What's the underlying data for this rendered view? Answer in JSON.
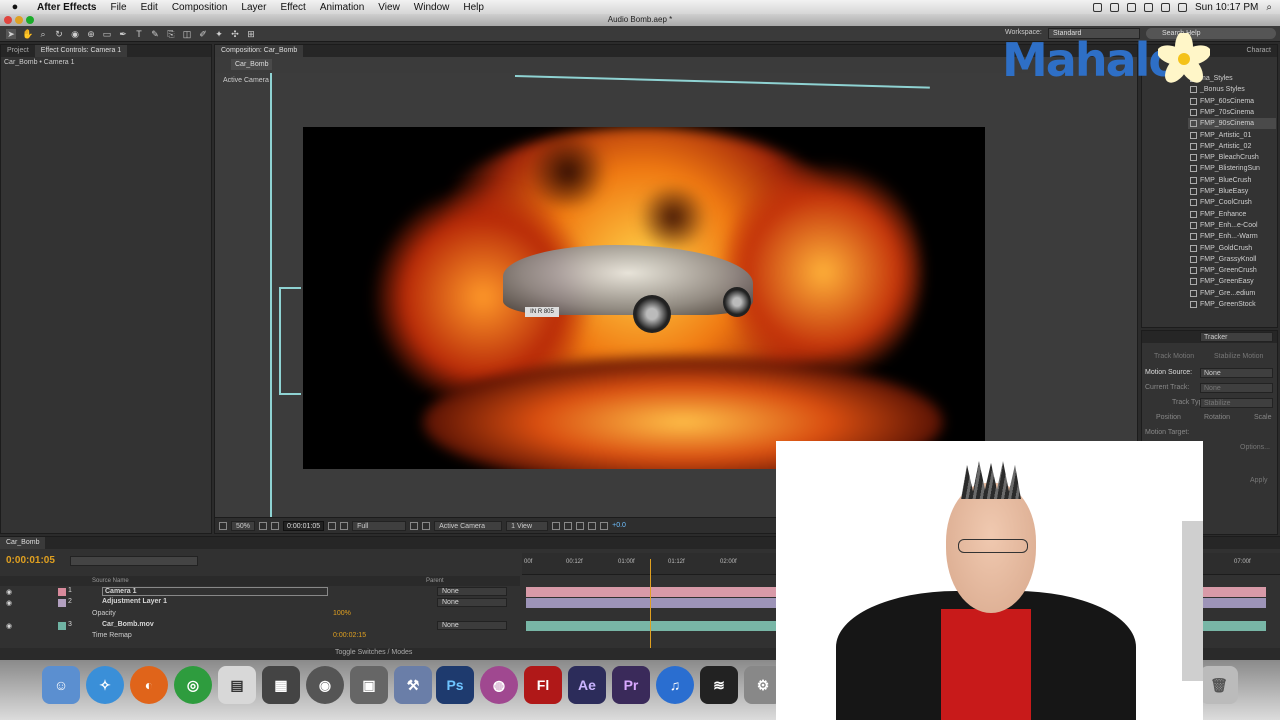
{
  "menubar": {
    "app": "After Effects",
    "items": [
      "File",
      "Edit",
      "Composition",
      "Layer",
      "Effect",
      "Animation",
      "View",
      "Window",
      "Help"
    ],
    "clock": "Sun 10:17 PM"
  },
  "window": {
    "title": "Audio Bomb.aep *"
  },
  "toolbar": {
    "workspace_label": "Workspace:",
    "workspace_value": "Standard",
    "search_placeholder": "Search Help"
  },
  "left_panel": {
    "tabs": [
      "Project",
      "Effect Controls: Camera 1"
    ],
    "subtitle": "Car_Bomb • Camera 1"
  },
  "viewer": {
    "tab": "Composition: Car_Bomb",
    "comp_tab": "Car_Bomb",
    "camera_label": "Active Camera",
    "zoom": "50%",
    "timecode": "0:00:01:05",
    "resolution": "Full",
    "camera_select": "Active Camera",
    "views": "1 View",
    "exposure": "+0.0",
    "plate_text": "IN R 805"
  },
  "effects_panel": {
    "tabs": [
      "Charact"
    ],
    "items": [
      "ma_Styles",
      "_Bonus Styles",
      "FMP_60sCinema",
      "FMP_70sCinema",
      "FMP_90sCinema",
      "FMP_Artistic_01",
      "FMP_Artistic_02",
      "FMP_BleachCrush",
      "FMP_BlisteringSun",
      "FMP_BlueCrush",
      "FMP_BlueEasy",
      "FMP_CoolCrush",
      "FMP_Enhance",
      "FMP_Enh...e-Cool",
      "FMP_Enh...-Warm",
      "FMP_GoldCrush",
      "FMP_GrassyKnoll",
      "FMP_GreenCrush",
      "FMP_GreenEasy",
      "FMP_Gre...edium",
      "FMP_GreenStock"
    ],
    "selected_index": 4
  },
  "tracker": {
    "title": "Tracker",
    "track_motion": "Track Motion",
    "stabilize_motion": "Stabilize Motion",
    "motion_source_label": "Motion Source:",
    "motion_source_value": "None",
    "current_track_label": "Current Track:",
    "current_track_value": "None",
    "track_type_label": "Track Type:",
    "track_type_value": "Stabilize",
    "position": "Position",
    "rotation": "Rotation",
    "scale": "Scale",
    "motion_target": "Motion Target:",
    "options": "Options...",
    "apply": "Apply"
  },
  "timeline": {
    "tab": "Car_Bomb",
    "timecode": "0:00:01:05",
    "source_name_header": "Source Name",
    "parent_header": "Parent",
    "layers": [
      {
        "num": "1",
        "name": "Camera 1",
        "parent": "None",
        "color": "#d88a9c"
      },
      {
        "num": "2",
        "name": "Adjustment Layer 1",
        "parent": "None",
        "color": "#b2a0c0"
      },
      {
        "num": "3",
        "name": "Car_Bomb.mov",
        "parent": "None",
        "color": "#6fb3a3"
      }
    ],
    "opacity_label": "Opacity",
    "opacity_value": "100%",
    "time_remap_label": "Time Remap",
    "time_remap_value": "0:00:02:15",
    "ruler_ticks": [
      "00f",
      "00:12f",
      "01:00f",
      "01:12f",
      "02:00f",
      "07:00f"
    ],
    "toggle_label": "Toggle Switches / Modes"
  },
  "dock": {
    "apps": [
      "Finder",
      "Safari",
      "Firefox",
      "Chrome",
      "Preview",
      "Final Cut",
      "DVD",
      "iPhoto",
      "Xcode",
      "Ps",
      "Color",
      "Fl",
      "Ae",
      "Pr",
      "iTunes",
      "Soundtrack",
      "System Prefs"
    ]
  },
  "watermark": {
    "text": "Mahalo"
  }
}
